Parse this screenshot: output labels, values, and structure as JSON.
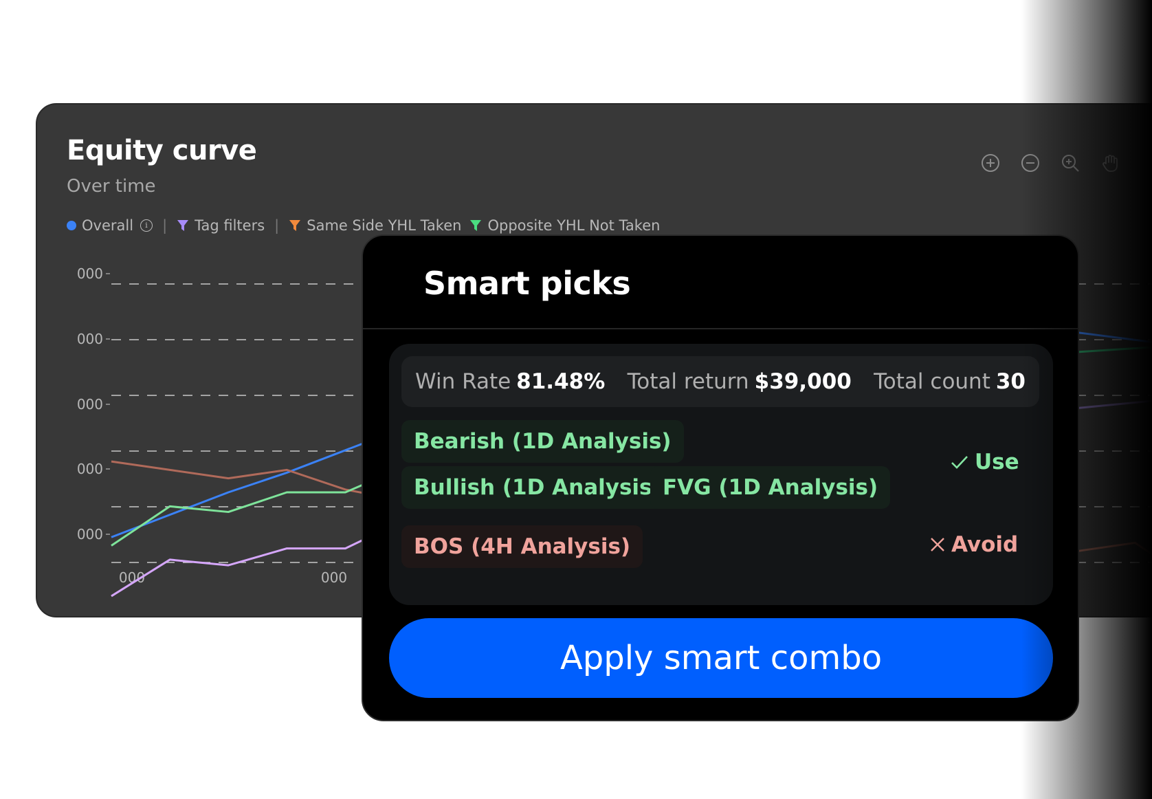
{
  "equity": {
    "title": "Equity curve",
    "subtitle": "Over time",
    "tools": [
      "zoom-in-plus-icon",
      "zoom-out-minus-icon",
      "magnifier-zoom-icon",
      "pan-hand-icon"
    ],
    "legend": {
      "overall": "Overall",
      "tag_filters": "Tag filters",
      "same_side": "Same Side YHL Taken",
      "opposite": "Opposite YHL Not Taken",
      "separator": "|"
    }
  },
  "chart_data": {
    "type": "line",
    "y_tick_labels": [
      "000",
      "000",
      "000",
      "000",
      "000"
    ],
    "x_tick_labels": [
      "000",
      "000"
    ],
    "grid": "dashed-horizontal",
    "ylim": [
      0,
      100
    ],
    "xlim": [
      0,
      36
    ],
    "series": [
      {
        "name": "Overall",
        "color": "#3b82f6",
        "x": [
          0,
          2,
          4,
          6,
          8,
          10,
          12,
          13
        ],
        "y": [
          9,
          17,
          25,
          32,
          40,
          48,
          56,
          61
        ]
      },
      {
        "name": "Same Side YHL Taken",
        "color": "#b06a5a",
        "x": [
          0,
          2,
          4,
          6,
          8,
          10,
          12,
          13
        ],
        "y": [
          36,
          33,
          30,
          33,
          26,
          22,
          19,
          17
        ]
      },
      {
        "name": "Opposite YHL Not Taken",
        "color": "#7ee39a",
        "x": [
          0,
          2,
          4,
          6,
          8,
          10,
          12,
          13
        ],
        "y": [
          6,
          20,
          18,
          25,
          25,
          34,
          34,
          34
        ]
      },
      {
        "name": "Tag filters",
        "color": "#d5a6fb",
        "x": [
          0,
          2,
          4,
          6,
          8,
          10,
          12,
          13
        ],
        "y": [
          -12,
          1,
          -1,
          5,
          5,
          15,
          15,
          15
        ]
      }
    ],
    "tail_segments_right": [
      {
        "color": "#3b82f6",
        "x": [
          33,
          36
        ],
        "y": [
          82,
          78
        ]
      },
      {
        "color": "#2ea56b",
        "x": [
          33,
          36
        ],
        "y": [
          75,
          77
        ]
      },
      {
        "color": "#7b6aa8",
        "x": [
          33,
          36
        ],
        "y": [
          55,
          58
        ]
      },
      {
        "color": "#8a5a4e",
        "x": [
          33,
          35,
          36
        ],
        "y": [
          4,
          7,
          0
        ]
      }
    ]
  },
  "colors": {
    "overall": "#3b82f6",
    "tag_filters": "#a78bfa",
    "same_side": "#f28a3c",
    "opposite": "#4ade80",
    "accent": "#005ffe",
    "use": "#86e6a3",
    "avoid": "#f0a39c"
  },
  "smart_picks": {
    "title": "Smart picks",
    "stats": {
      "win_rate_label": "Win Rate",
      "win_rate_value": "81.48%",
      "total_return_label": "Total return",
      "total_return_value": "$39,000",
      "total_count_label": "Total count",
      "total_count_value": "30"
    },
    "use_chips": [
      "Bearish (1D Analysis)",
      "Bullish  (1D Analysis)",
      "FVG  (1D Analysis)"
    ],
    "use_label": "Use",
    "avoid_chips": [
      "BOS (4H Analysis)"
    ],
    "avoid_label": "Avoid",
    "apply_label": "Apply smart combo"
  }
}
